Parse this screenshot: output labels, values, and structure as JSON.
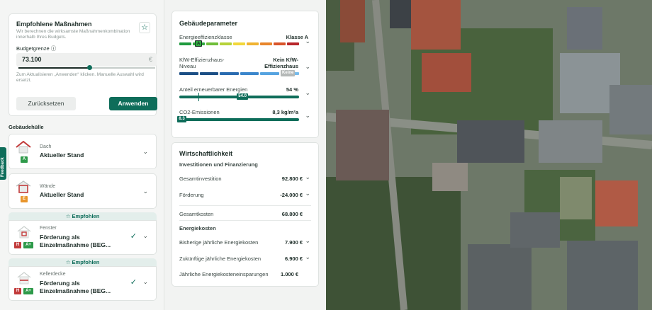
{
  "recommendations": {
    "title": "Empfohlene Maßnahmen",
    "subtitle": "Wir berechnen die wirksamste Maßnahmenkombination innerhalb Ihres Budgets.",
    "budget_label": "Budgetgrenze ⓘ",
    "budget_value": "73.100",
    "currency": "€",
    "slider_fraction": 0.52,
    "hint": "Zum Aktualisieren „Anwenden“ klicken. Manuelle Auswahl wird ersetzt.",
    "reset_label": "Zurücksetzen",
    "apply_label": "Anwenden"
  },
  "feedback_label": "Feedback",
  "envelope": {
    "heading": "Gebäudehülle",
    "recommended_label": "☆ Empfohlen",
    "items": [
      {
        "kind": "Dach",
        "state": "Aktueller Stand",
        "badges": [
          {
            "text": "A",
            "color": "#2e9a4a"
          }
        ],
        "recommended": false,
        "icon_color": "#c23b3b"
      },
      {
        "kind": "Wände",
        "state": "Aktueller Stand",
        "badges": [
          {
            "text": "E",
            "color": "#e8962c"
          }
        ],
        "recommended": false,
        "icon_color": "#c23b3b"
      },
      {
        "kind": "Fenster",
        "state": "Förderung als Einzelmaßnahme (BEG...",
        "badges": [
          {
            "text": "H",
            "color": "#c23b3b"
          },
          {
            "text": "A+",
            "color": "#2e9a4a"
          }
        ],
        "recommended": true,
        "icon_color": "#c23b3b"
      },
      {
        "kind": "Kellerdecke",
        "state": "Förderung als Einzelmaßnahme (BEG...",
        "badges": [
          {
            "text": "H",
            "color": "#c23b3b"
          },
          {
            "text": "A+",
            "color": "#2e9a4a"
          }
        ],
        "recommended": true,
        "icon_color": "#c23b3b"
      }
    ]
  },
  "building_params": {
    "title": "Gebäudeparameter",
    "efficiency": {
      "label": "Energieeffizienzklasse",
      "value": "Klasse A",
      "marker": "A",
      "colors": [
        "#1f9a3e",
        "#2eaa3e",
        "#6fbe3a",
        "#b6d23a",
        "#f2d73a",
        "#f0b331",
        "#e8862c",
        "#d9542a",
        "#b8262a"
      ]
    },
    "kfw": {
      "label": "KfW-Effizienzhaus-Niveau",
      "value": "Kein KfW-Effizienzhaus",
      "marker": "Keine",
      "colors": [
        "#1c4f85",
        "#1c4f85",
        "#2a6bb0",
        "#3b86cc",
        "#56a3e0",
        "#78bceb"
      ]
    },
    "renewable": {
      "label": "Anteil erneuerbarer Energien",
      "value": "54 %",
      "marker": "54.0",
      "fraction": 0.54
    },
    "co2": {
      "label": "CO2-Emissionen",
      "value": "8,3 kg/m²a",
      "marker": "8.3",
      "fraction": 0.02
    }
  },
  "economics": {
    "title": "Wirtschaftlichkeit",
    "invest_heading": "Investitionen und Finanzierung",
    "total_invest_label": "Gesamtinvestition",
    "total_invest_value": "92.800 €",
    "funding_label": "Förderung",
    "funding_value": "-24.000 €",
    "total_cost_label": "Gesamtkosten",
    "total_cost_value": "68.800 €",
    "energy_heading": "Energiekosten",
    "prev_cost_label": "Bisherige jährliche Energiekosten",
    "prev_cost_value": "7.900 €",
    "future_cost_label": "Zukünftige jährliche Energiekosten",
    "future_cost_value": "6.900 €",
    "savings_label": "Jährliche Energiekosteneinsparungen",
    "savings_value": "1.000 €"
  }
}
